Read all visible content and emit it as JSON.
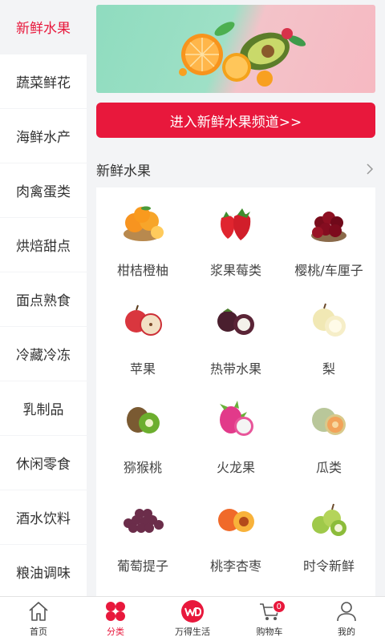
{
  "sidebar": {
    "items": [
      {
        "label": "新鲜水果",
        "active": true
      },
      {
        "label": "蔬菜鲜花"
      },
      {
        "label": "海鲜水产"
      },
      {
        "label": "肉禽蛋类"
      },
      {
        "label": "烘焙甜点"
      },
      {
        "label": "面点熟食"
      },
      {
        "label": "冷藏冷冻"
      },
      {
        "label": "乳制品"
      },
      {
        "label": "休闲零食"
      },
      {
        "label": "酒水饮料"
      },
      {
        "label": "粮油调味"
      }
    ]
  },
  "main": {
    "channel_button": "进入新鲜水果频道>>",
    "section_title": "新鲜水果",
    "categories": [
      {
        "label": "柑桔橙柚",
        "icon": "oranges-icon"
      },
      {
        "label": "浆果莓类",
        "icon": "strawberry-icon"
      },
      {
        "label": "樱桃/车厘子",
        "icon": "cherries-icon"
      },
      {
        "label": "苹果",
        "icon": "apple-icon"
      },
      {
        "label": "热带水果",
        "icon": "mangosteen-icon"
      },
      {
        "label": "梨",
        "icon": "pear-icon"
      },
      {
        "label": "猕猴桃",
        "icon": "kiwi-icon"
      },
      {
        "label": "火龙果",
        "icon": "dragonfruit-icon"
      },
      {
        "label": "瓜类",
        "icon": "melon-icon"
      },
      {
        "label": "葡萄提子",
        "icon": "grapes-icon"
      },
      {
        "label": "桃李杏枣",
        "icon": "peach-icon"
      },
      {
        "label": "时令新鲜",
        "icon": "seasonal-fruit-icon"
      }
    ]
  },
  "tabbar": {
    "tabs": [
      {
        "label": "首页",
        "icon": "home-icon"
      },
      {
        "label": "分类",
        "icon": "category-icon",
        "active": true
      },
      {
        "label": "万得生活",
        "icon": "wd-logo-icon"
      },
      {
        "label": "购物车",
        "icon": "cart-icon",
        "badge": "0"
      },
      {
        "label": "我的",
        "icon": "user-icon"
      }
    ]
  },
  "colors": {
    "accent": "#e8183c",
    "background": "#f3f4f6"
  }
}
